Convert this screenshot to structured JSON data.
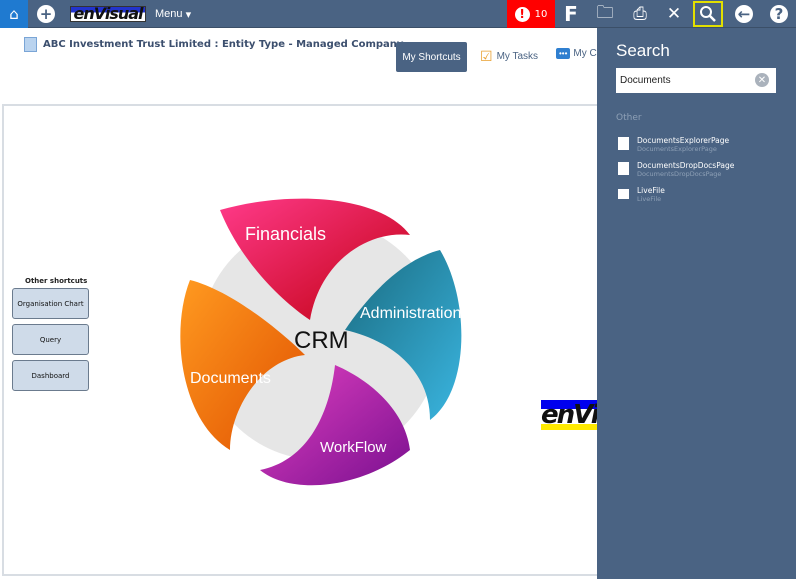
{
  "topbar": {
    "menu_label": "Menu",
    "logo_text": "enVisual",
    "alert_count": "10",
    "icons": [
      "home-icon",
      "plus-icon",
      "alert-icon",
      "forms-icon",
      "folder-add-icon",
      "print-icon",
      "tools-icon",
      "search-icon",
      "back-icon",
      "help-icon"
    ]
  },
  "page": {
    "title": "ABC Investment Trust Limited : Entity Type - Managed Company",
    "tabs": {
      "shortcuts": "My Shortcuts",
      "tasks": "My Tasks",
      "messages": "My Comments"
    },
    "other_shortcuts_label": "Other shortcuts",
    "shortcuts": [
      "Organisation Chart",
      "Query",
      "Dashboard"
    ],
    "crm": {
      "center": "CRM",
      "segments": [
        "Financials",
        "Administration",
        "WorkFlow",
        "Documents"
      ]
    },
    "logo_text": "enVisual"
  },
  "search": {
    "title": "Search",
    "value": "Documents",
    "group": "Other",
    "results": [
      {
        "title": "DocumentsExplorerPage",
        "subtitle": "DocumentsExplorerPage"
      },
      {
        "title": "DocumentsDropDocsPage",
        "subtitle": "DocumentsDropDocsPage"
      },
      {
        "title": "LiveFile",
        "subtitle": "LiveFile"
      }
    ]
  },
  "colors": {
    "bar": "#4a6383",
    "alert": "#ff0000",
    "highlight": "#e3e000"
  }
}
